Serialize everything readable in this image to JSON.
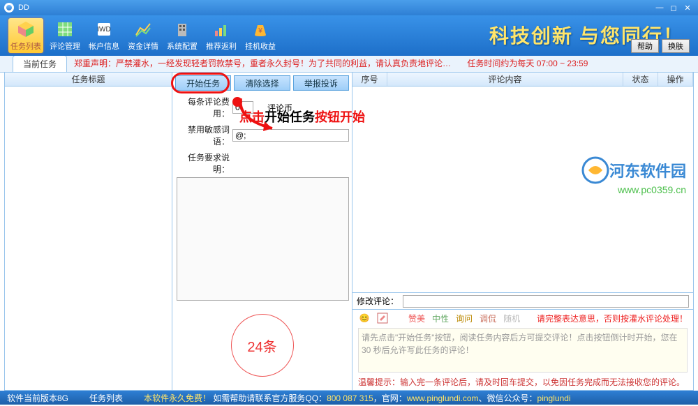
{
  "window": {
    "title": "DD"
  },
  "toolbar": {
    "items": [
      {
        "label": "任务列表"
      },
      {
        "label": "评论管理"
      },
      {
        "label": "帐户信息"
      },
      {
        "label": "资金详情"
      },
      {
        "label": "系统配置"
      },
      {
        "label": "推荐返利"
      },
      {
        "label": "挂机收益"
      }
    ],
    "slogan": "科技创新 与您同行！",
    "help": "帮助",
    "switch": "换肤"
  },
  "tab": {
    "current": "当前任务"
  },
  "notice": {
    "prefix": "郑重声明：",
    "body": "严禁灌水，一经发现轻者罚款禁号，重者永久封号！为了共同的利益，请认真负责地评论…",
    "time_label": "任务时间约为每天 07:00 ~ 23:59"
  },
  "leftcol": {
    "header": "任务标题"
  },
  "mid": {
    "btn_start": "开始任务",
    "btn_clear": "清除选择",
    "btn_report": "举报投诉",
    "fee_label": "每条评论费用：",
    "fee_value": "0.",
    "fee_unit": "评论币",
    "sens_label": "禁用敏感词语：",
    "sens_value": "@;",
    "req_label": "任务要求说明：",
    "annotation_1": "点击",
    "annotation_2": "开始任务",
    "annotation_3": "按钮开始",
    "count": "24条"
  },
  "table": {
    "cols": {
      "seq": "序号",
      "content": "评论内容",
      "status": "状态",
      "op": "操作"
    },
    "modify_label": "修改评论："
  },
  "watermark": {
    "name": "河东软件园",
    "url": "www.pc0359.cn"
  },
  "sentiment": {
    "praise": "赞美",
    "neutral": "中性",
    "ask": "询问",
    "tease": "调侃",
    "random": "随机"
  },
  "editor": {
    "warn": "请完整表达意思，否则按灌水评论处理！",
    "placeholder": "请先点击\"开始任务\"按钮，阅读任务内容后方可提交评论！点击按钮倒计时开始，您在 30 秒后允许写此任务的评论！",
    "tip": "温馨提示：输入完一条评论后，请及时回车提交，以免因任务完成而无法接收您的评论。"
  },
  "status": {
    "ver": "软件当前版本8G",
    "list": "任务列表",
    "free": "本软件永久免费！",
    "contact_pre": "如需帮助请联系官方服务QQ：",
    "qq": "800 087 315",
    "site_pre": "，官网：",
    "site": "www.pinglundi.com",
    "wx_pre": "、微信公众号：",
    "wx": "pinglundi"
  }
}
